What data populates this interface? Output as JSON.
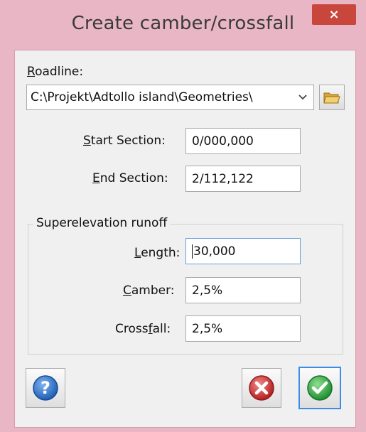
{
  "window": {
    "title": "Create camber/crossfall",
    "close_glyph": "×"
  },
  "roadline": {
    "label_access": "R",
    "label_rest": "oadline:",
    "value": "C:\\Projekt\\Adtollo island\\Geometries\\"
  },
  "start_section": {
    "label_access": "S",
    "label_rest": "tart Section:",
    "value": "0/000,000"
  },
  "end_section": {
    "label_access": "E",
    "label_rest": "nd Section:",
    "value": "2/112,122"
  },
  "runoff": {
    "group_label": "Superelevation runoff",
    "length": {
      "label_access": "L",
      "label_rest": "ength:",
      "value": "30,000"
    },
    "camber": {
      "label_access": "C",
      "label_rest": "amber:",
      "value": "2,5%"
    },
    "crossfall": {
      "label_pre": "Cross",
      "label_access": "f",
      "label_rest": "all:",
      "value": "2,5%"
    }
  },
  "buttons": {
    "help_icon": "help-icon",
    "cancel_icon": "cancel-icon",
    "ok_icon": "ok-icon"
  },
  "colors": {
    "frame": "#e8b6c4",
    "close": "#c8463c",
    "help": "#2f6fc8",
    "cancel": "#d23a3a",
    "ok": "#2fa64a",
    "focus": "#3a8ee6"
  }
}
